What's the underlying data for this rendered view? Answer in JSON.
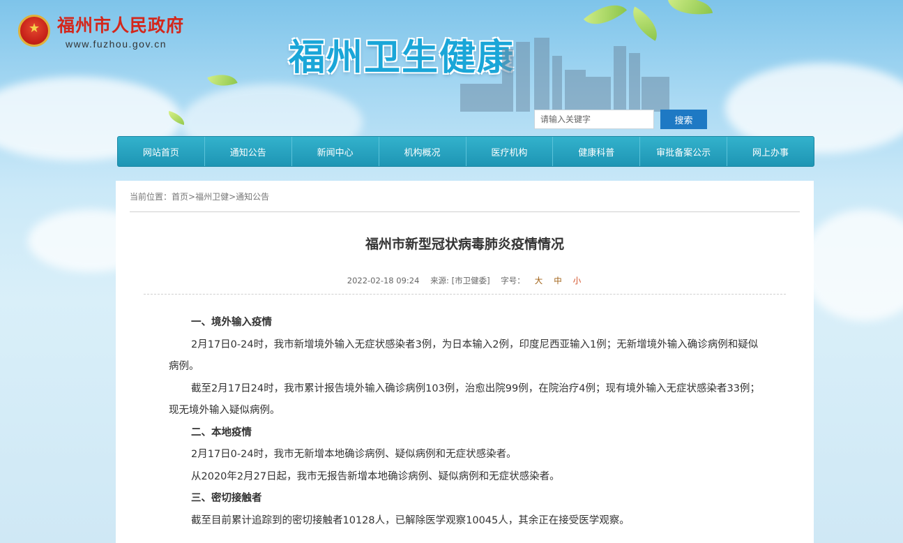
{
  "header": {
    "gov_title": "福州市人民政府",
    "gov_url": "www.fuzhou.gov.cn",
    "site_title": "福州卫生健康"
  },
  "search": {
    "placeholder": "请输入关键字",
    "button_label": "搜索"
  },
  "nav": {
    "items": [
      "网站首页",
      "通知公告",
      "新闻中心",
      "机构概况",
      "医疗机构",
      "健康科普",
      "审批备案公示",
      "网上办事"
    ]
  },
  "breadcrumb": {
    "prefix": "当前位置：",
    "home": "首页",
    "sep1": ">",
    "section": "福州卫健",
    "sep2": ">",
    "current": "通知公告"
  },
  "article": {
    "title": "福州市新型冠状病毒肺炎疫情情况",
    "date": "2022-02-18 09:24",
    "source": "来源: [市卫健委]",
    "font_label": "字号：",
    "font_large": "大",
    "font_medium": "中",
    "font_small": "小",
    "paragraphs": [
      {
        "type": "heading",
        "text": "一、境外输入疫情"
      },
      {
        "type": "text",
        "text": "2月17日0-24时，我市新增境外输入无症状感染者3例，为日本输入2例，印度尼西亚输入1例；无新增境外输入确诊病例和疑似病例。"
      },
      {
        "type": "text",
        "text": "截至2月17日24时，我市累计报告境外输入确诊病例103例，治愈出院99例，在院治疗4例；现有境外输入无症状感染者33例；现无境外输入疑似病例。"
      },
      {
        "type": "heading",
        "text": "二、本地疫情"
      },
      {
        "type": "text",
        "text": "2月17日0-24时，我市无新增本地确诊病例、疑似病例和无症状感染者。"
      },
      {
        "type": "text",
        "text": "从2020年2月27日起，我市无报告新增本地确诊病例、疑似病例和无症状感染者。"
      },
      {
        "type": "heading",
        "text": "三、密切接触者"
      },
      {
        "type": "text",
        "text": "截至目前累计追踪到的密切接触者10128人，已解除医学观察10045人，其余正在接受医学观察。"
      }
    ]
  }
}
